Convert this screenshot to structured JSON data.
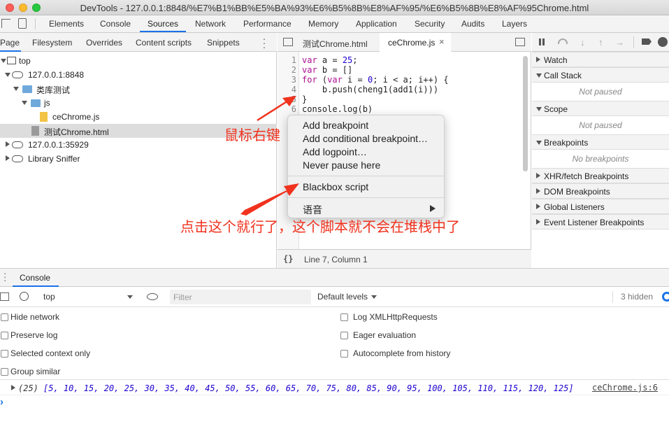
{
  "window": {
    "title": "DevTools - 127.0.0.1:8848/%E7%B1%BB%E5%BA%93%E6%B5%8B%E8%AF%95/%E6%B5%8B%E8%AF%95Chrome.html"
  },
  "main_tabs": [
    "Elements",
    "Console",
    "Sources",
    "Network",
    "Performance",
    "Memory",
    "Application",
    "Security",
    "Audits",
    "Layers"
  ],
  "active_main_tab": "Sources",
  "navigator": {
    "tabs": [
      "Page",
      "Filesystem",
      "Overrides",
      "Content scripts",
      "Snippets"
    ],
    "tree": {
      "top": "top",
      "host1": "127.0.0.1:8848",
      "folder": "类库测试",
      "subfolder": "js",
      "file_js": "ceChrome.js",
      "file_html": "测试Chrome.html",
      "host2": "127.0.0.1:35929",
      "library": "Library Sniffer"
    }
  },
  "editor": {
    "tabs": {
      "html": "测试Chrome.html",
      "js": "ceChrome.js"
    },
    "line_numbers": [
      "1",
      "2",
      "3",
      "4",
      "5",
      "6"
    ],
    "code": {
      "l1_kw": "var",
      "l1_rest": " a = ",
      "l1_num": "25",
      "l1_end": ";",
      "l2_kw": "var",
      "l2_rest": " b = []",
      "l3_kw": "for",
      "l3_a": " (",
      "l3_kw2": "var",
      "l3_b": " i = ",
      "l3_num": "0",
      "l3_c": "; i < a; i++) {",
      "l4": "    b.push(cheng1(add1(i)))",
      "l5": "}",
      "l6": "console.log(b)"
    },
    "status": "Line 7, Column 1",
    "format_icon": "{}"
  },
  "debugger": {
    "sections": {
      "watch": "Watch",
      "call_stack": "Call Stack",
      "scope": "Scope",
      "breakpoints": "Breakpoints",
      "xhr": "XHR/fetch Breakpoints",
      "dom": "DOM Breakpoints",
      "global": "Global Listeners",
      "event": "Event Listener Breakpoints"
    },
    "not_paused": "Not paused",
    "no_breakpoints": "No breakpoints"
  },
  "context_menu": {
    "add_breakpoint": "Add breakpoint",
    "add_conditional": "Add conditional breakpoint…",
    "add_logpoint": "Add logpoint…",
    "never_pause": "Never pause here",
    "blackbox": "Blackbox script",
    "language": "语音"
  },
  "annotations": {
    "right_click": "鼠标右键",
    "click_note": "点击这个就行了，这个脚本就不会在堆栈中了"
  },
  "console": {
    "tab": "Console",
    "context": "top",
    "filter_placeholder": "Filter",
    "levels": "Default levels",
    "hidden": "3 hidden",
    "settings": {
      "hide_network": "Hide network",
      "preserve_log": "Preserve log",
      "selected_context": "Selected context only",
      "group_similar": "Group similar",
      "log_xhr": "Log XMLHttpRequests",
      "eager_eval": "Eager evaluation",
      "autocomplete": "Autocomplete from history"
    },
    "log": {
      "count": "(25)",
      "values": "[5, 10, 15, 20, 25, 30, 35, 40, 45, 50, 55, 60, 65, 70, 75, 80, 85, 90, 95, 100, 105, 110, 115, 120, 125]",
      "source": "ceChrome.js:6"
    },
    "prompt": "›"
  },
  "colors": {
    "accent": "#1a73e8",
    "annotation": "#f0321e",
    "keyword": "#aa0d91",
    "number": "#1c00cf"
  }
}
